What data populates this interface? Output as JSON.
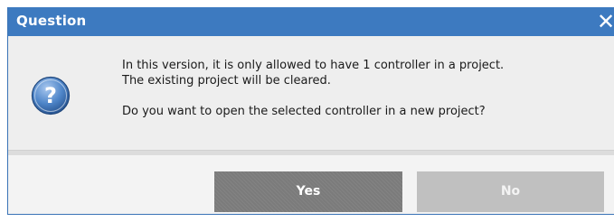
{
  "dialog": {
    "title": "Question",
    "close_glyph": "✕",
    "icon": "question-icon",
    "message_lines": [
      "In this version, it is only allowed to have 1 controller in a project.",
      "The existing project will be cleared.",
      "Do you want to open the selected controller in a new project?"
    ],
    "buttons": {
      "yes_label": "Yes",
      "no_label": "No"
    }
  },
  "colors": {
    "titlebar": "#3d7ac0",
    "yes_button": "#7b7b7b",
    "no_button": "#c0c0c0",
    "icon_gradient_top": "#8fb6e6",
    "icon_gradient_bottom": "#2d5e9f"
  }
}
